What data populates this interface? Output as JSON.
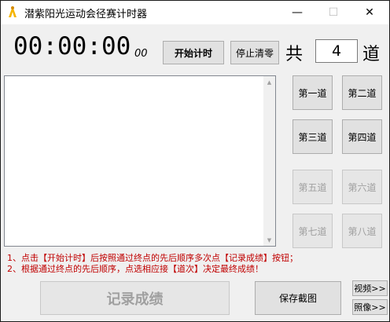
{
  "window": {
    "title": "潜紫阳光运动会径赛计时器",
    "minimize": "—",
    "maximize": "☐",
    "close": "✕"
  },
  "timer": {
    "time": "00:00:00",
    "ms": "00"
  },
  "controls": {
    "start_label": "开始计时",
    "stop_label": "停止清零",
    "lanes_prefix": "共",
    "lanes_value": "4",
    "lanes_suffix": "道"
  },
  "lanes": [
    {
      "label": "第一道",
      "enabled": true
    },
    {
      "label": "第二道",
      "enabled": true
    },
    {
      "label": "第三道",
      "enabled": true
    },
    {
      "label": "第四道",
      "enabled": true
    },
    {
      "label": "第五道",
      "enabled": false
    },
    {
      "label": "第六道",
      "enabled": false
    },
    {
      "label": "第七道",
      "enabled": false
    },
    {
      "label": "第八道",
      "enabled": false
    }
  ],
  "instructions": [
    "1、点击【开始计时】后按照通过终点的先后顺序多次点【记录成绩】按钮；",
    "2、根据通过终点的先后顺序，点选相应接【道次】决定最终成绩！"
  ],
  "bottom": {
    "record_label": "记录成绩",
    "save_label": "保存截图",
    "video_label": "视频>>",
    "photo_label": "照像>>"
  },
  "colors": {
    "instruction_text": "#c00000",
    "app_icon": "#f5b400"
  }
}
